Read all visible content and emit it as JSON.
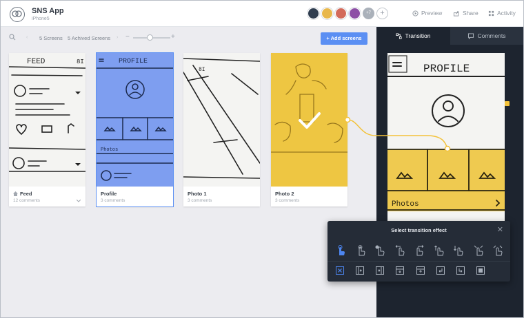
{
  "app": {
    "title": "SNS App",
    "subtitle": "iPhone5"
  },
  "header": {
    "avatars_more": "+7",
    "actions": {
      "preview": "Preview",
      "share": "Share",
      "activity": "Activity"
    }
  },
  "toolbar": {
    "screens_count": "5 Screens",
    "archived_count": "5 Achived Screens",
    "add_label": "Add screens",
    "zoom_minus": "−",
    "zoom_plus": "+"
  },
  "screens": [
    {
      "name": "Feed",
      "comments": "12 comments"
    },
    {
      "name": "Profile",
      "comments": "3 comments"
    },
    {
      "name": "Photo 1",
      "comments": "3 comments"
    },
    {
      "name": "Photo  2",
      "comments": "3 comments"
    }
  ],
  "panel": {
    "tabs": {
      "transition": "Transition",
      "comments": "Comments"
    },
    "preview_title": "PROFILE",
    "preview_photos": "Photos"
  },
  "sketch": {
    "feed_title": "FEED",
    "feed_badge": "8I",
    "profile_title": "PROFILE",
    "profile_photos": "Photos",
    "photo1_badge": "8I"
  },
  "popup": {
    "title": "Select transition effect",
    "close": "✕"
  },
  "colors": {
    "accent_blue": "#5b8ff3",
    "highlight_yellow": "#f3c23a",
    "panel_dark": "#1d242f",
    "canvas_bg": "#ececf0"
  }
}
